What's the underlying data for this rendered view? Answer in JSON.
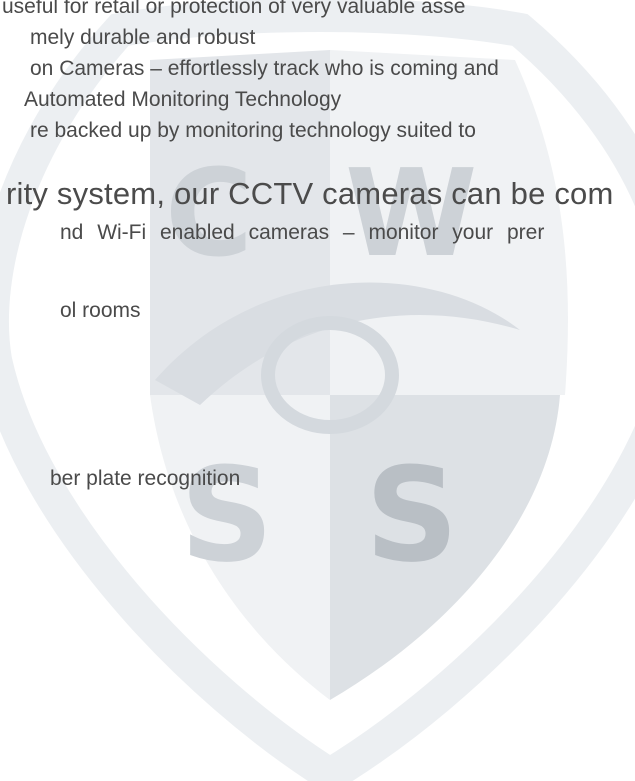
{
  "lines": [
    "useful for retail or protection of very valuable asse",
    "mely durable and robust",
    "on Cameras – effortlessly track who is coming and",
    " Automated Monitoring Technology",
    "re backed up by monitoring technology suited to",
    "rity system, our CCTV cameras can be com",
    "nd Wi-Fi enabled cameras – monitor your prer",
    "ol rooms",
    "ber plate recognition"
  ],
  "watermark": {
    "letters": [
      "C",
      "W",
      "S",
      "S"
    ],
    "colors": {
      "outline": "#eceff2",
      "panel_dark": "#dfe3e7",
      "panel_light": "#eceff2",
      "letter": "#c9ced3",
      "letter_dark": "#b8bec4"
    }
  }
}
